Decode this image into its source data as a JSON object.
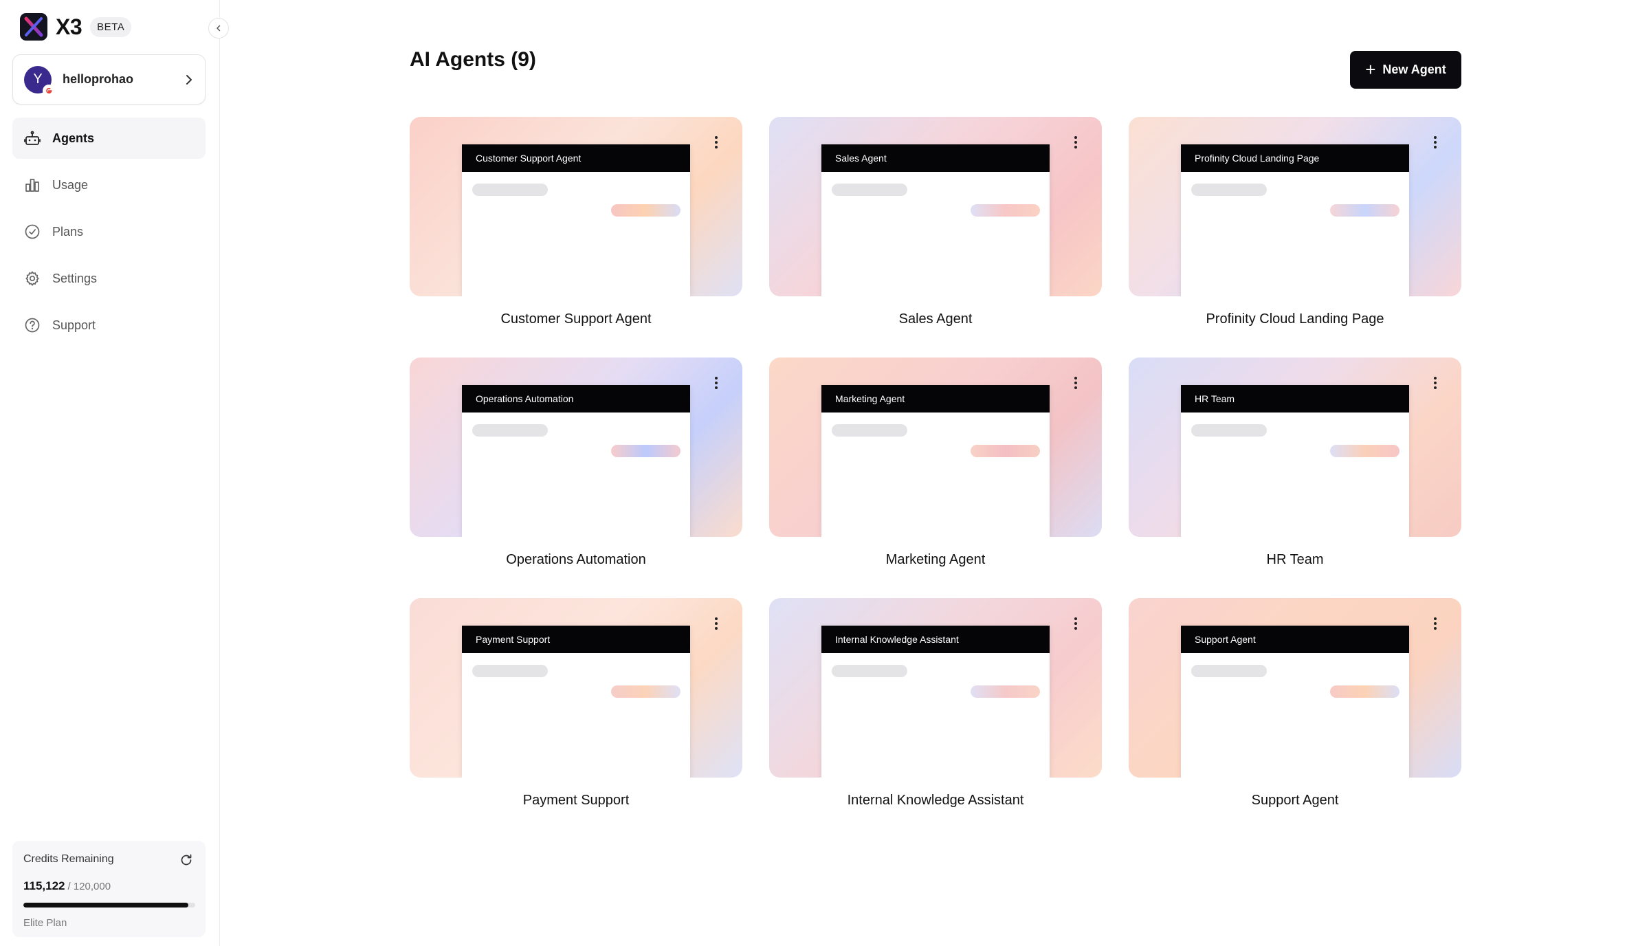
{
  "brand": {
    "name": "X3",
    "badge": "BETA"
  },
  "user": {
    "initial": "Y",
    "name": "helloprohao"
  },
  "nav": [
    {
      "label": "Agents",
      "icon": "robot-icon",
      "active": true
    },
    {
      "label": "Usage",
      "icon": "bar-chart-icon",
      "active": false
    },
    {
      "label": "Plans",
      "icon": "check-circle-icon",
      "active": false
    },
    {
      "label": "Settings",
      "icon": "gear-icon",
      "active": false
    },
    {
      "label": "Support",
      "icon": "help-circle-icon",
      "active": false
    }
  ],
  "credits": {
    "title": "Credits Remaining",
    "used": "115,122",
    "total": "/ 120,000",
    "progress": 0.96,
    "plan": "Elite Plan"
  },
  "main": {
    "title": "AI Agents (9)",
    "new_button": "New Agent"
  },
  "agents": [
    {
      "name": "Customer Support Agent",
      "header": "Customer Support Agent",
      "gradient": "linear-gradient(135deg, #fbd0c8 0%, #fbe3da 45%, #fdd7bf 70%, #dfe1f5 100%)",
      "pill": "linear-gradient(90deg, #f7c6c2, #fcd2b2, #d9dcf5)"
    },
    {
      "name": "Sales Agent",
      "header": "Sales Agent",
      "gradient": "linear-gradient(135deg, #dfe0f6 0%, #f5d6dc 40%, #f7c5c7 75%, #fbd6c5 100%)",
      "pill": "linear-gradient(90deg, #dfe0f6, #f7c7c6, #fad2c4)"
    },
    {
      "name": "Profinity Cloud Landing Page",
      "header": "Profinity Cloud Landing Page",
      "gradient": "linear-gradient(135deg, #fbe0d3 0%, #f1dfe9 40%, #cdd8fb 70%, #f8d6d8 100%)",
      "pill": "linear-gradient(90deg, #f6d6d8, #c8d5fb, #f6d2d4)"
    },
    {
      "name": "Operations Automation",
      "header": "Operations Automation",
      "gradient": "linear-gradient(135deg, #f9d6d6 0%, #e5dcf4 45%, #c6d0fb 70%, #fbdccd 100%)",
      "pill": "linear-gradient(90deg, #f7cccb, #bccafb, #f3cad0)"
    },
    {
      "name": "Marketing Agent",
      "header": "Marketing Agent",
      "gradient": "linear-gradient(135deg, #fbd8c8 0%, #f8cfcf 45%, #f3c3c6 70%, #dcdcf3 100%)",
      "pill": "linear-gradient(90deg, #f8d2c6, #f4bfc3, #f6cfc3)"
    },
    {
      "name": "HR Team",
      "header": "HR Team",
      "gradient": "linear-gradient(135deg, #d9ddf7 0%, #efdcea 40%, #fbd6c7 70%, #f6cbc3 100%)",
      "pill": "linear-gradient(90deg, #dcdff6, #fbd0b9, #f6c6c6)"
    },
    {
      "name": "Payment Support",
      "header": "Payment Support",
      "gradient": "linear-gradient(135deg, #fadcd6 0%, #fde5dc 45%, #fcd9c4 70%, #dee2f7 100%)",
      "pill": "linear-gradient(90deg, #f6cdc9, #fbd3b8, #dfe0f5)"
    },
    {
      "name": "Internal Knowledge Assistant",
      "header": "Internal Knowledge Assistant",
      "gradient": "linear-gradient(135deg, #dfe1f6 0%, #f2d8de 40%, #f7ccce 70%, #fcdcc9 100%)",
      "pill": "linear-gradient(90deg, #e0e0f5, #f5c9c9, #f9d4c6)"
    },
    {
      "name": "Support Agent",
      "header": "Support Agent",
      "gradient": "linear-gradient(135deg, #f9d3cf 0%, #fcd6c3 40%, #fbd3c0 70%, #d8ddf7 100%)",
      "pill": "linear-gradient(90deg, #f7cbc6, #fcd2b5, #dcdff6)"
    }
  ]
}
